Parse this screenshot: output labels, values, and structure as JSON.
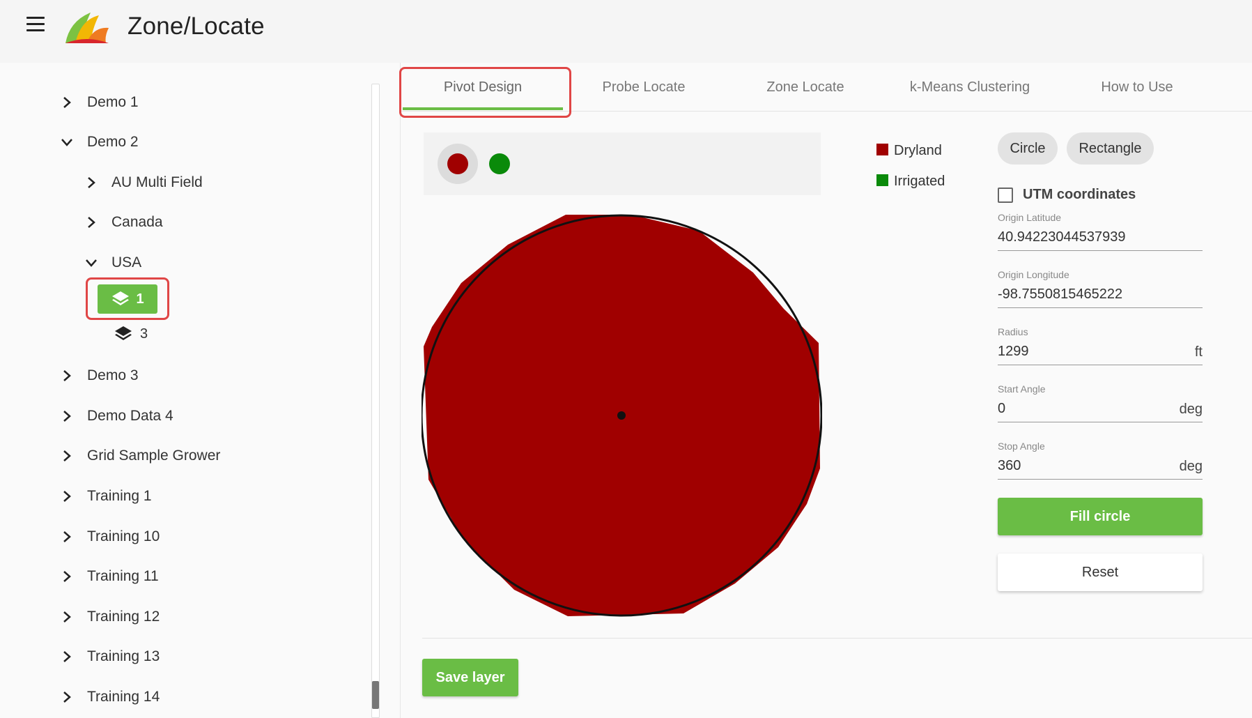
{
  "app": {
    "title": "Zone/Locate",
    "menu_icon": "hamburger-icon",
    "logo": "zone-locate-logo"
  },
  "sidebar": {
    "tree": [
      {
        "label": "Demo 1",
        "expanded": false
      },
      {
        "label": "Demo 2",
        "expanded": true
      },
      {
        "label": "AU Multi Field",
        "expanded": false
      },
      {
        "label": "Canada",
        "expanded": false
      },
      {
        "label": "USA",
        "expanded": true
      },
      {
        "label": "Demo 3",
        "expanded": false
      },
      {
        "label": "Demo Data 4",
        "expanded": false
      },
      {
        "label": "Grid Sample Grower",
        "expanded": false
      },
      {
        "label": "Training 1",
        "expanded": false
      },
      {
        "label": "Training 10",
        "expanded": false
      },
      {
        "label": "Training 11",
        "expanded": false
      },
      {
        "label": "Training 12",
        "expanded": false
      },
      {
        "label": "Training 13",
        "expanded": false
      },
      {
        "label": "Training 14",
        "expanded": false
      }
    ],
    "layers": [
      {
        "label": "1",
        "selected": true
      },
      {
        "label": "3",
        "selected": false
      }
    ]
  },
  "tabs": [
    {
      "label": "Pivot Design",
      "active": true
    },
    {
      "label": "Probe Locate",
      "active": false
    },
    {
      "label": "Zone Locate",
      "active": false
    },
    {
      "label": "k-Means Clustering",
      "active": false
    },
    {
      "label": "How to Use",
      "active": false
    }
  ],
  "colors": {
    "dryland": "#a00000",
    "irrigated": "#0a8a0a",
    "accent": "#6abd45",
    "highlight": "#e04646"
  },
  "legend": [
    {
      "label": "Dryland",
      "color": "#a00000"
    },
    {
      "label": "Irrigated",
      "color": "#0a8a0a"
    }
  ],
  "shapes": {
    "circle": "Circle",
    "rectangle": "Rectangle"
  },
  "utm": {
    "label": "UTM coordinates",
    "checked": false
  },
  "fields": {
    "origin_lat": {
      "label": "Origin Latitude",
      "value": "40.94223044537939"
    },
    "origin_lon": {
      "label": "Origin Longitude",
      "value": "-98.7550815465222"
    },
    "radius": {
      "label": "Radius",
      "value": "1299",
      "unit": "ft"
    },
    "start_angle": {
      "label": "Start Angle",
      "value": "0",
      "unit": "deg"
    },
    "stop_angle": {
      "label": "Stop Angle",
      "value": "360",
      "unit": "deg"
    }
  },
  "buttons": {
    "fill_circle": "Fill circle",
    "reset": "Reset",
    "save_layer": "Save layer"
  }
}
